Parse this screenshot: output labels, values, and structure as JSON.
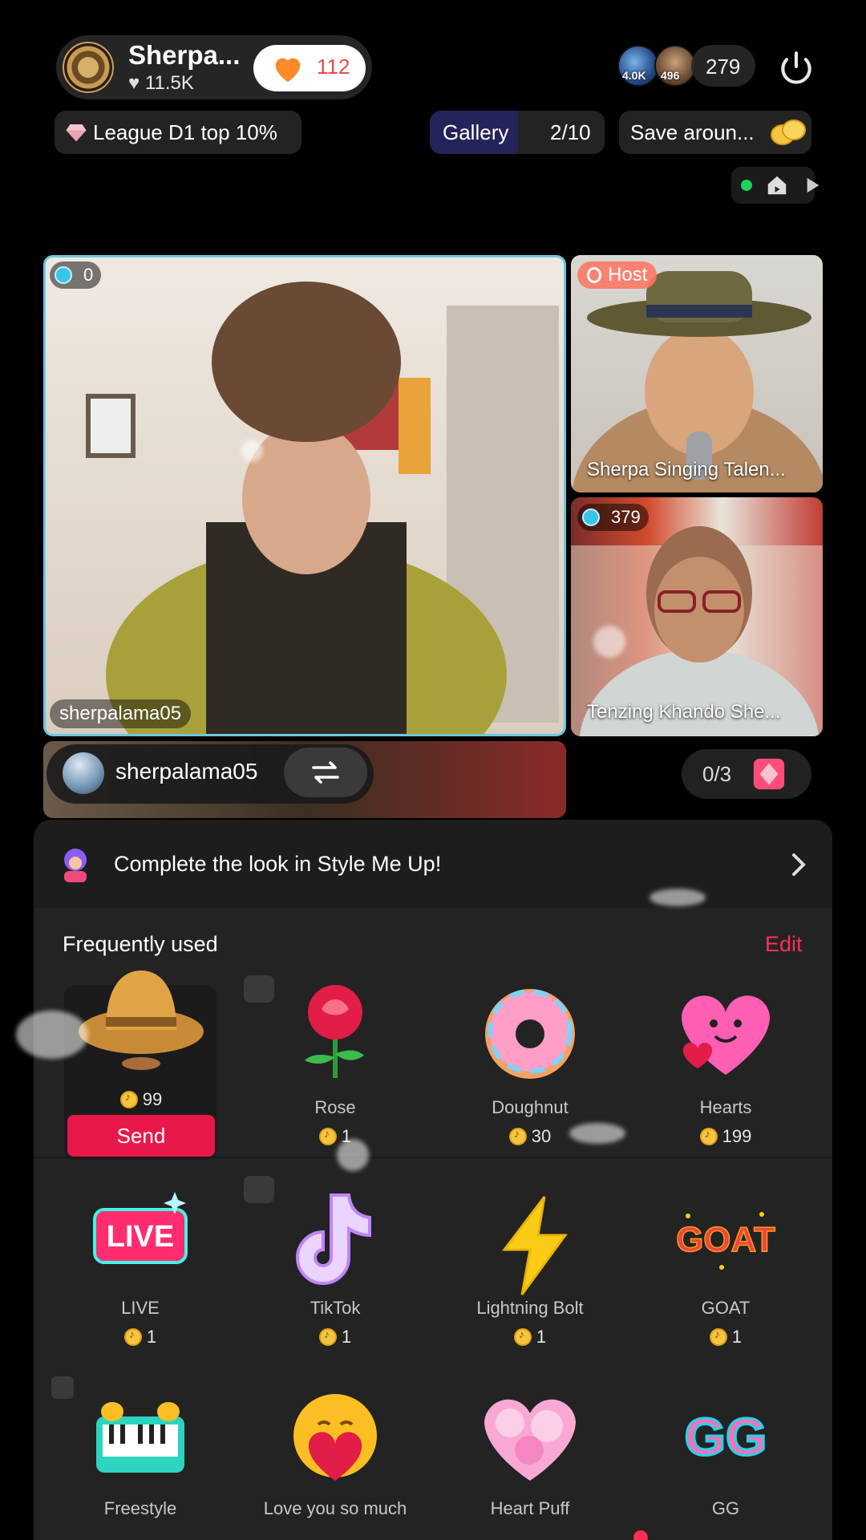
{
  "header": {
    "creator_name": "Sherpa...",
    "creator_likes": "11.5K",
    "follow_count": "112",
    "viewer_badge_1": "4.0K",
    "viewer_badge_2": "496",
    "viewer_count": "279"
  },
  "chips": {
    "league": "League D1 top 10%",
    "gallery_label": "Gallery",
    "gallery_progress": "2/10",
    "save": "Save aroun..."
  },
  "tiles": {
    "main": {
      "gem_count": "0",
      "username": "sherpalama05"
    },
    "host": {
      "badge": "Host",
      "name": "Sherpa Singing Talen..."
    },
    "guest": {
      "gem_count": "379",
      "name": "Tenzing Khando She..."
    }
  },
  "pip": {
    "username": "sherpalama05",
    "slots": "0/3"
  },
  "sheet": {
    "promo": "Complete the look in Style Me Up!",
    "section_title": "Frequently used",
    "edit_label": "Edit",
    "send_label": "Send",
    "gifts": [
      {
        "name": "",
        "price": "99",
        "icon": "cowboy-hat-icon"
      },
      {
        "name": "Rose",
        "price": "1",
        "icon": "rose-icon"
      },
      {
        "name": "Doughnut",
        "price": "30",
        "icon": "doughnut-icon"
      },
      {
        "name": "Hearts",
        "price": "199",
        "icon": "hearts-icon"
      },
      {
        "name": "LIVE",
        "price": "1",
        "icon": "live-icon"
      },
      {
        "name": "TikTok",
        "price": "1",
        "icon": "tiktok-icon"
      },
      {
        "name": "Lightning Bolt",
        "price": "1",
        "icon": "lightning-icon"
      },
      {
        "name": "GOAT",
        "price": "1",
        "icon": "goat-icon"
      },
      {
        "name": "Freestyle",
        "icon": "piano-icon"
      },
      {
        "name": "Love you so much",
        "icon": "hug-heart-icon"
      },
      {
        "name": "Heart Puff",
        "icon": "heart-puff-icon"
      },
      {
        "name": "GG",
        "icon": "gg-icon"
      }
    ],
    "live_art_text": "LIVE",
    "goat_art_text": "GOAT",
    "gg_art_text": "GG"
  },
  "colors": {
    "accent": "#ff2d55",
    "send": "#e8194a",
    "tile_border": "#6ec8dd"
  }
}
